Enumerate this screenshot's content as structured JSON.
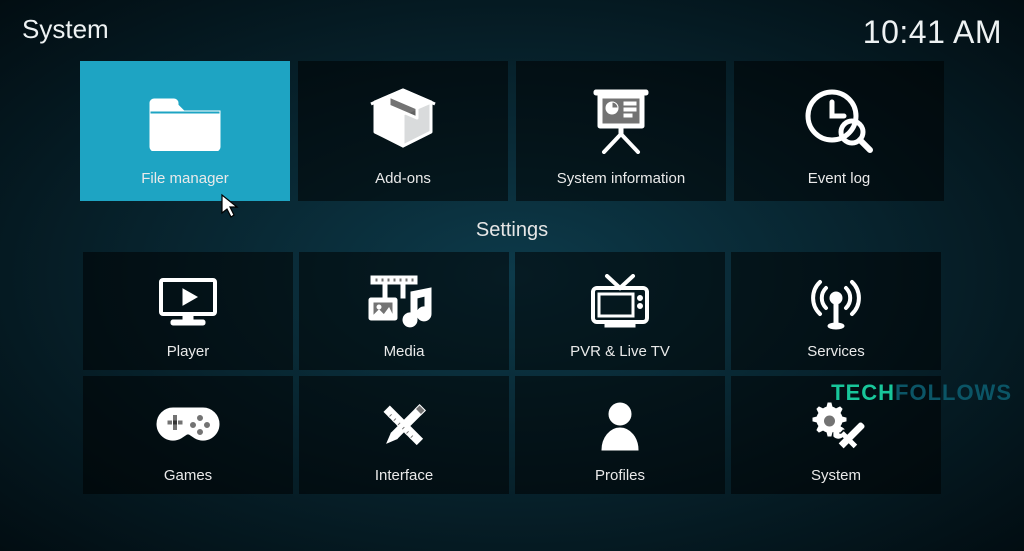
{
  "header": {
    "title": "System",
    "clock": "10:41 AM"
  },
  "top_tiles": [
    {
      "label": "File manager",
      "icon": "folder-icon",
      "selected": true
    },
    {
      "label": "Add-ons",
      "icon": "box-icon",
      "selected": false
    },
    {
      "label": "System information",
      "icon": "presentation-icon",
      "selected": false
    },
    {
      "label": "Event log",
      "icon": "clock-search-icon",
      "selected": false
    }
  ],
  "section_title": "Settings",
  "settings_tiles": [
    {
      "label": "Player",
      "icon": "monitor-play-icon"
    },
    {
      "label": "Media",
      "icon": "media-collection-icon"
    },
    {
      "label": "PVR & Live TV",
      "icon": "tv-icon"
    },
    {
      "label": "Services",
      "icon": "broadcast-icon"
    },
    {
      "label": "Games",
      "icon": "gamepad-icon"
    },
    {
      "label": "Interface",
      "icon": "pencil-ruler-icon"
    },
    {
      "label": "Profiles",
      "icon": "person-icon"
    },
    {
      "label": "System",
      "icon": "gear-tools-icon"
    }
  ],
  "watermark": {
    "part1": "TECH",
    "part2": "FOLLOWS"
  }
}
